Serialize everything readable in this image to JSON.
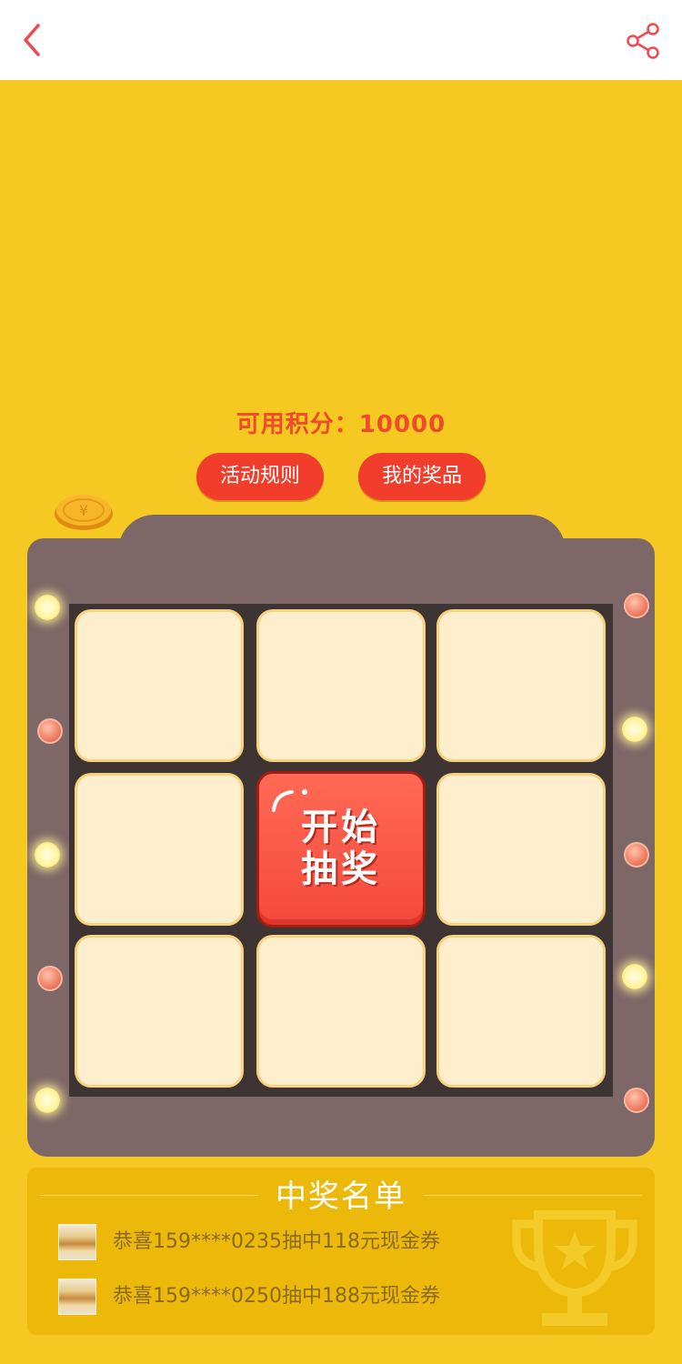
{
  "header": {
    "back_icon": "chevron-left-icon",
    "share_icon": "share-icon",
    "accent_color": "#f0494f"
  },
  "points": {
    "label": "可用积分：",
    "value": "10000"
  },
  "buttons": {
    "rules_label": "活动规则",
    "prizes_label": "我的奖品"
  },
  "lottery": {
    "start_label_line1": "开始",
    "start_label_line2": "抽奖",
    "cells_count_visible": 8
  },
  "winners": {
    "title": "中奖名单",
    "items": [
      {
        "text": "恭喜159****0235抽中118元现金券"
      },
      {
        "text": "恭喜159****0250抽中188元现金券"
      }
    ]
  },
  "colors": {
    "background": "#f5c922",
    "machine": "#7d6767",
    "cell_fill": "#feeecd",
    "start_button": "#f4493c",
    "pill_button": "#f23d2b"
  }
}
